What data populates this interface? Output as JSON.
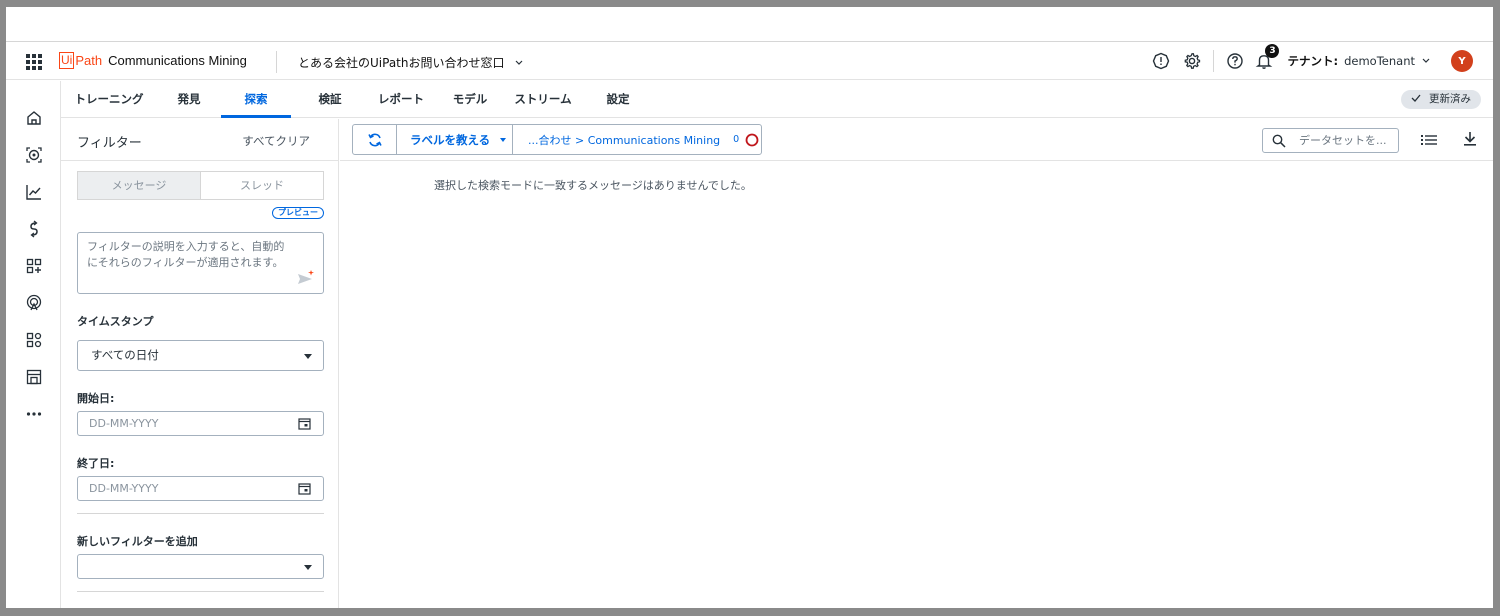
{
  "header": {
    "logo_box": "Ui",
    "logo_path": "Path",
    "product": "Communications Mining",
    "workspace": "とある会社のUiPathお問い合わせ窓口",
    "notification_count": "3",
    "tenant_label": "テナント:",
    "tenant_name": "demoTenant",
    "avatar_initial": "Y"
  },
  "tabs": [
    {
      "label": "トレーニング"
    },
    {
      "label": "発見"
    },
    {
      "label": "探索"
    },
    {
      "label": "検証"
    },
    {
      "label": "レポート"
    },
    {
      "label": "モデル"
    },
    {
      "label": "ストリーム"
    },
    {
      "label": "設定"
    }
  ],
  "active_tab": "探索",
  "status_chip": "更新済み",
  "filters": {
    "title": "フィルター",
    "clear_all": "すべてクリア",
    "segment": [
      "メッセージ",
      "スレッド"
    ],
    "preview_badge": "プレビュー",
    "description_placeholder_line1": "フィルターの説明を入力すると、自動的",
    "description_placeholder_line2": "にそれらのフィルターが適用されます。",
    "timestamp_label": "タイムスタンプ",
    "timestamp_value": "すべての日付",
    "start_label": "開始日:",
    "start_placeholder": "DD-MM-YYYY",
    "end_label": "終了日:",
    "end_placeholder": "DD-MM-YYYY",
    "add_filter_label": "新しいフィルターを追加",
    "add_filter_value": ""
  },
  "toolbar": {
    "teach_label": "ラベルを教える",
    "breadcrumb": "...合わせ > Communications Mining",
    "count": "0",
    "search_placeholder": "データセットを..."
  },
  "results": {
    "empty_message": "選択した検索モードに一致するメッセージはありませんでした。"
  },
  "colors": {
    "accent": "#0067df",
    "brand": "#fa4616"
  }
}
